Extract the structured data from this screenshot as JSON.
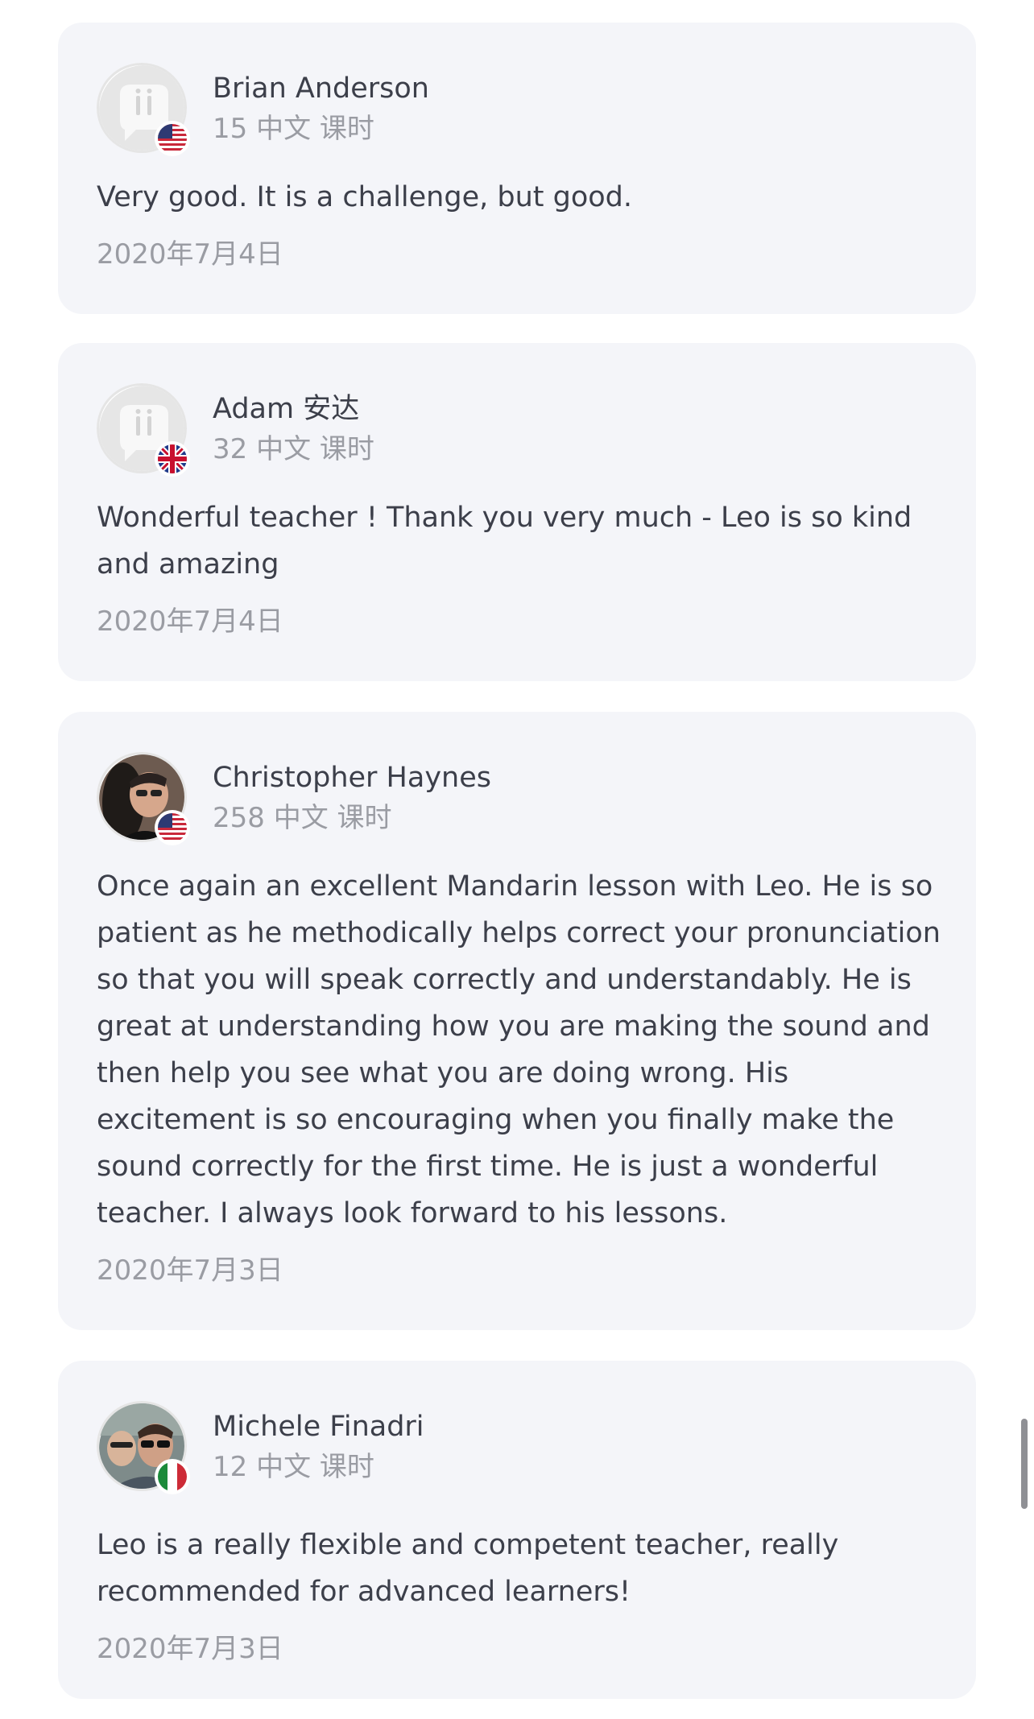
{
  "colors": {
    "card_background": "#f4f5f9",
    "primary_text": "#3c3f4a",
    "secondary_text": "#9a9ca3"
  },
  "reviews": [
    {
      "name": "Brian Anderson",
      "hours": "15 中文 课时",
      "comment": "Very good. It is a challenge, but good.",
      "date": "2020年7月4日",
      "avatar": "default-avatar-icon",
      "flag": "us-flag-icon"
    },
    {
      "name": "Adam 安达",
      "hours": "32 中文 课时",
      "comment": "Wonderful teacher ! Thank you very much - Leo is so kind and amazing",
      "date": "2020年7月4日",
      "avatar": "default-avatar-icon",
      "flag": "uk-flag-icon"
    },
    {
      "name": "Christopher Haynes",
      "hours": "258 中文 课时",
      "comment": "Once again an excellent Mandarin lesson with Leo. He is so patient as he methodically helps correct your pronunciation so that you will speak correctly and understandably. He is great at understanding how you are making the sound and then help you see what you are doing wrong. His excitement is so encouraging when you finally make the sound correctly for the first time. He is just a wonderful teacher. I always look forward to his lessons.",
      "date": "2020年7月3日",
      "avatar": "user-photo",
      "flag": "us-flag-icon"
    },
    {
      "name": "Michele Finadri",
      "hours": "12 中文 课时",
      "comment": "Leo is a really flexible and competent teacher, really recommended for advanced learners!",
      "date": "2020年7月3日",
      "avatar": "user-photo",
      "flag": "italy-flag-icon"
    }
  ]
}
